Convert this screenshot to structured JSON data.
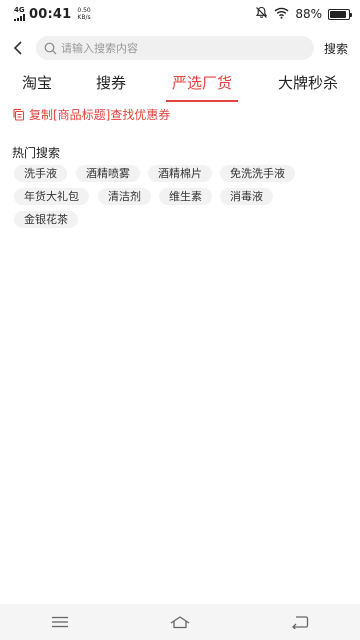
{
  "status_bar": {
    "network": "4G",
    "time": "00:41",
    "speed_value": "0.50",
    "speed_unit": "KB/s",
    "battery": "88%",
    "battery_level": 0.88
  },
  "search": {
    "placeholder": "请输入搜索内容",
    "value": "",
    "button_label": "搜索"
  },
  "tabs": [
    {
      "label": "淘宝",
      "active": false
    },
    {
      "label": "搜券",
      "active": false
    },
    {
      "label": "严选厂货",
      "active": true
    },
    {
      "label": "大牌秒杀",
      "active": false
    }
  ],
  "copy_tip": "复制[商品标题]查找优惠券",
  "hot_search": {
    "title": "热门搜索",
    "items": [
      "洗手液",
      "酒精喷雾",
      "酒精棉片",
      "免洗洗手液",
      "年货大礼包",
      "清洁剂",
      "维生素",
      "消毒液",
      "金银花茶"
    ]
  },
  "colors": {
    "accent": "#e64340",
    "chip_bg": "#f2f2f2",
    "nav_bg": "#f5f5f5"
  },
  "icons": {
    "back": "chevron-left-icon",
    "search": "search-icon",
    "copy": "copy-icon",
    "nav_menu": "menu-icon",
    "nav_home": "home-icon",
    "nav_back": "return-icon"
  }
}
